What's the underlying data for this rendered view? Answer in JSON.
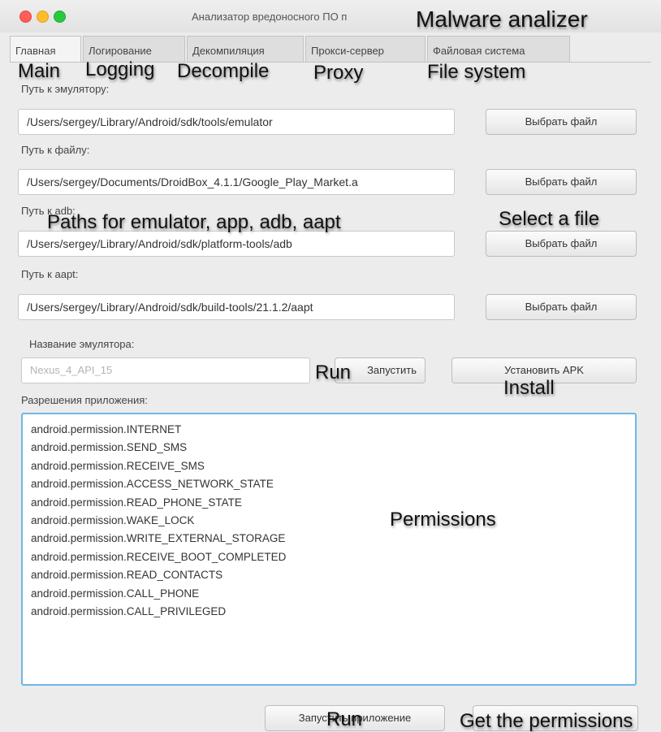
{
  "window": {
    "title": "Анализатор вредоносного ПО п"
  },
  "tabs": [
    {
      "label": "Главная",
      "active": true
    },
    {
      "label": "Логирование",
      "active": false
    },
    {
      "label": "Декомпиляция",
      "active": false
    },
    {
      "label": "Прокси-сервер",
      "active": false
    },
    {
      "label": "Файловая система",
      "active": false
    }
  ],
  "captions": {
    "title": "Malware analizer",
    "main": "Main",
    "logging": "Logging",
    "decompile": "Decompile",
    "proxy": "Proxy",
    "file_system": "File system",
    "paths": "Paths for emulator, app, adb, aapt",
    "select_file": "Select a file",
    "run_emulator": "Run",
    "install": "Install",
    "permissions": "Permissions",
    "run_app": "Run",
    "get_permissions": "Get the permissions"
  },
  "form": {
    "emulator_label": "Путь к эмулятору:",
    "emulator_path": "/Users/sergey/Library/Android/sdk/tools/emulator",
    "file_label": "Путь к файлу:",
    "file_path": "/Users/sergey/Documents/DroidBox_4.1.1/Google_Play_Market.a",
    "adb_label": "Путь к adb:",
    "adb_path": "/Users/sergey/Library/Android/sdk/platform-tools/adb",
    "aapt_label": "Путь к aapt:",
    "aapt_path": "/Users/sergey/Library/Android/sdk/build-tools/21.1.2/aapt",
    "choose_file_button": "Выбрать файл",
    "emulator_name_label": "Название эмулятора:",
    "emulator_name_placeholder": "Nexus_4_API_15",
    "launch_button": "Запустить",
    "install_apk_button": "Установить APK",
    "permissions_label": "Разрешения приложения:",
    "launch_app_button": "Запустить приложение",
    "get_permissions_button": ""
  },
  "permissions": [
    "android.permission.INTERNET",
    "android.permission.SEND_SMS",
    "android.permission.RECEIVE_SMS",
    "android.permission.ACCESS_NETWORK_STATE",
    "android.permission.READ_PHONE_STATE",
    "android.permission.WAKE_LOCK",
    "android.permission.WRITE_EXTERNAL_STORAGE",
    "android.permission.RECEIVE_BOOT_COMPLETED",
    "android.permission.READ_CONTACTS",
    "android.permission.CALL_PHONE",
    "android.permission.CALL_PRIVILEGED"
  ],
  "colors": {
    "focus_border": "#6cb8e6",
    "close": "#ff5f57",
    "minimize": "#ffbd2e",
    "zoom": "#28c940"
  }
}
